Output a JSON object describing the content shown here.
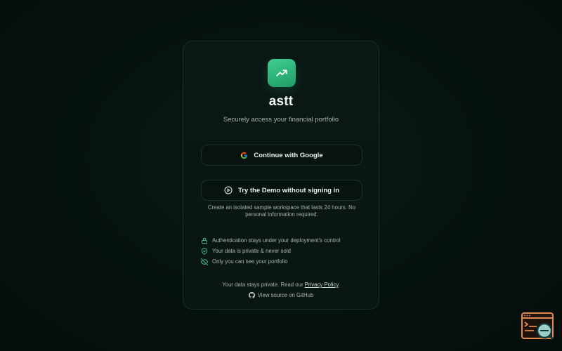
{
  "app": {
    "name": "astt",
    "tagline": "Securely access your financial portfolio"
  },
  "auth": {
    "google_label": "Continue with Google",
    "demo_label": "Try the Demo without signing in",
    "demo_note": "Create an isolated sample workspace that lasts 24 hours. No personal information required."
  },
  "features": [
    {
      "icon": "lock-icon",
      "text": "Authentication stays under your deployment's control"
    },
    {
      "icon": "shield-check-icon",
      "text": "Your data is private & never sold"
    },
    {
      "icon": "eye-off-icon",
      "text": "Only you can see your portfolio"
    }
  ],
  "footer": {
    "privacy_prefix": "Your data stays private. Read our",
    "privacy_link": "Privacy Policy",
    "privacy_suffix": ".",
    "github_label": "View source on GitHub"
  },
  "colors": {
    "background": "#06110e",
    "card": "#0b1815",
    "accent": "#3fcf91",
    "text": "#e8f0ed",
    "muted": "#a4b3ae",
    "widget_orange": "#e2894d"
  }
}
